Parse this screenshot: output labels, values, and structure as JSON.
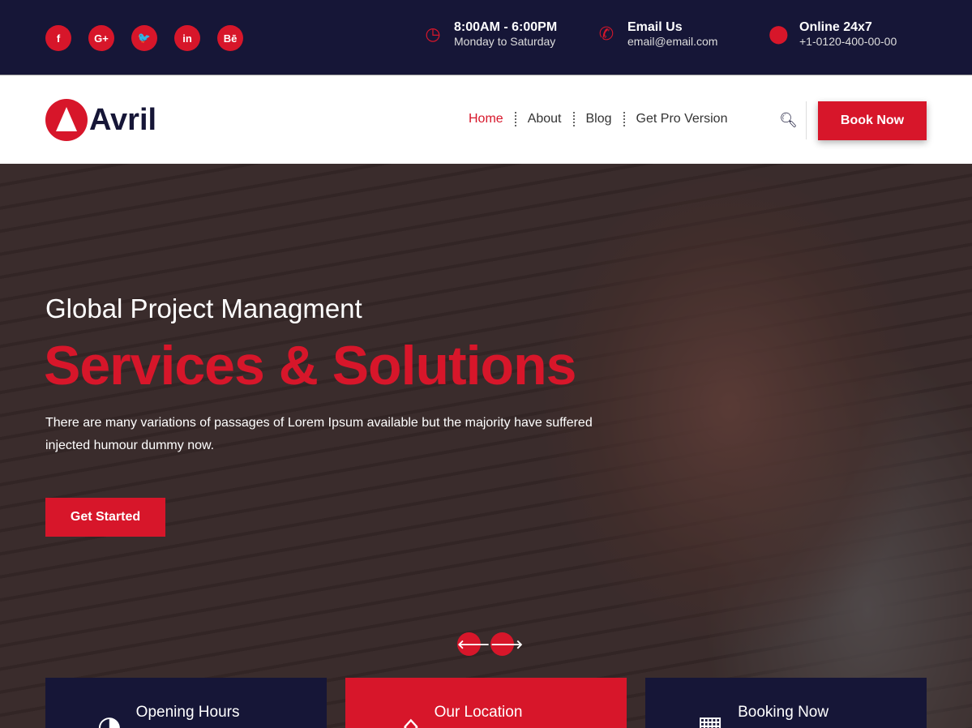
{
  "topbar": {
    "social": [
      {
        "icon": "facebook-icon",
        "glyph": "f"
      },
      {
        "icon": "google-plus-icon",
        "glyph": "G+"
      },
      {
        "icon": "twitter-icon",
        "glyph": "🐦"
      },
      {
        "icon": "linkedin-icon",
        "glyph": "in"
      },
      {
        "icon": "behance-icon",
        "glyph": "Bē"
      }
    ],
    "hours": {
      "title": "8:00AM - 6:00PM",
      "sub": "Monday to Saturday",
      "icon": "clock-icon"
    },
    "email": {
      "title": "Email Us",
      "sub": "email@email.com",
      "icon": "phone-icon"
    },
    "online": {
      "title": "Online 24x7",
      "sub": "+1-0120-400-00-00",
      "icon": "location-pin-icon"
    }
  },
  "nav": {
    "logo": "Avril",
    "items": [
      "Home",
      "About",
      "Blog",
      "Get Pro Version"
    ],
    "active": "Home",
    "book_label": "Book Now"
  },
  "hero": {
    "subtitle": "Global Project Managment",
    "title": "Services & Solutions",
    "text": "There are many variations of passages of Lorem Ipsum available but the majority have suffered injected humour dummy now.",
    "cta": "Get Started",
    "prev": "🡐",
    "next": "🡒"
  },
  "cards": [
    {
      "title": "Opening Hours",
      "icon": "clock-icon"
    },
    {
      "title": "Our Location",
      "icon": "home-icon"
    },
    {
      "title": "Booking Now",
      "icon": "calendar-icon"
    }
  ],
  "colors": {
    "accent": "#d7162a",
    "navy": "#161637"
  }
}
